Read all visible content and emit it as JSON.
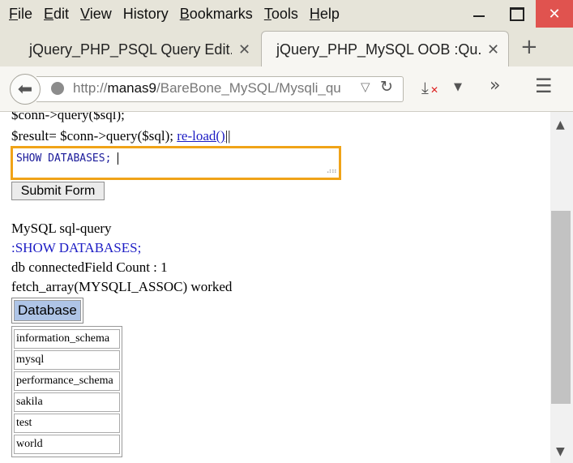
{
  "menu": {
    "items": [
      {
        "u": "F",
        "rest": "ile"
      },
      {
        "u": "E",
        "rest": "dit"
      },
      {
        "u": "V",
        "rest": "iew"
      },
      {
        "u": "",
        "rest": "History",
        "u_mid": "s"
      },
      {
        "u": "B",
        "rest": "ookmarks"
      },
      {
        "u": "T",
        "rest": "ools"
      },
      {
        "u": "H",
        "rest": "elp"
      }
    ]
  },
  "tabs": [
    {
      "title": "jQuery_PHP_PSQL Query Edit...",
      "close": "✕"
    },
    {
      "title": "jQuery_PHP_MySQL OOB :Qu...",
      "close": "✕"
    }
  ],
  "new_tab_label": "+",
  "url": {
    "prefix": "http://",
    "host": "manas9",
    "path": "/BareBone_MySQL/Mysqli_qu"
  },
  "page": {
    "line1": "$conn->query($sql);",
    "line2": "$result= $conn->query($sql);",
    "reload_link": "re-load()",
    "line2_tail": "||",
    "sql_text": "SHOW DATABASES;",
    "submit_label": "Submit Form",
    "heading": "MySQL sql-query",
    "query_echo": ":SHOW DATABASES;",
    "connected": "db connectedField Count : 1",
    "fetch": "fetch_array(MYSQLI_ASSOC) worked",
    "table_header": "Database",
    "databases": [
      "information_schema",
      "mysql",
      "performance_schema",
      "sakila",
      "test",
      "world"
    ]
  },
  "colors": {
    "textarea_border": "#f0a318",
    "link": "#1c1cc4",
    "header_bg": "#aec4e6",
    "close_btn": "#e0534f"
  }
}
